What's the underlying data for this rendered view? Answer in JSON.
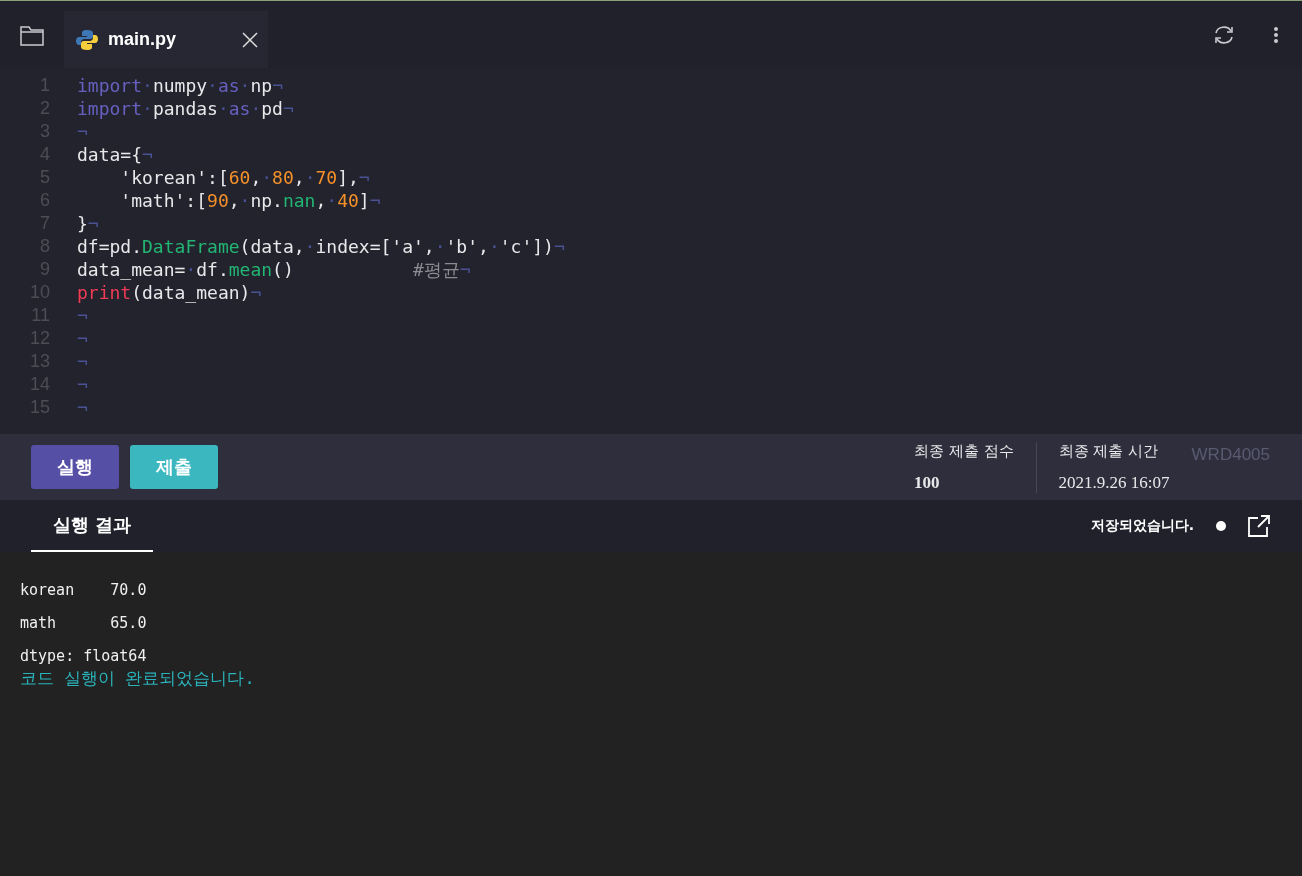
{
  "tabs": [
    {
      "label": "main.py",
      "selected": true
    }
  ],
  "editor": {
    "lines": [
      {
        "number": "1",
        "tokens": [
          {
            "kind": "kw",
            "text": "import"
          },
          {
            "kind": "ws",
            "text": "·"
          },
          {
            "kind": "id",
            "text": "numpy"
          },
          {
            "kind": "ws",
            "text": "·"
          },
          {
            "kind": "kw",
            "text": "as"
          },
          {
            "kind": "ws",
            "text": "·"
          },
          {
            "kind": "id",
            "text": "np"
          },
          {
            "kind": "ws",
            "text": "¬"
          }
        ]
      },
      {
        "number": "2",
        "tokens": [
          {
            "kind": "kw",
            "text": "import"
          },
          {
            "kind": "ws",
            "text": "·"
          },
          {
            "kind": "id",
            "text": "pandas"
          },
          {
            "kind": "ws",
            "text": "·"
          },
          {
            "kind": "kw",
            "text": "as"
          },
          {
            "kind": "ws",
            "text": "·"
          },
          {
            "kind": "id",
            "text": "pd"
          },
          {
            "kind": "ws",
            "text": "¬"
          }
        ]
      },
      {
        "number": "3",
        "tokens": [
          {
            "kind": "ws",
            "text": "¬"
          }
        ]
      },
      {
        "number": "4",
        "tokens": [
          {
            "kind": "id",
            "text": "data={"
          },
          {
            "kind": "ws",
            "text": "¬"
          }
        ]
      },
      {
        "number": "5",
        "tokens": [
          {
            "kind": "id",
            "text": "    'korean':["
          },
          {
            "kind": "num",
            "text": "60"
          },
          {
            "kind": "id",
            "text": ","
          },
          {
            "kind": "ws",
            "text": "·"
          },
          {
            "kind": "num",
            "text": "80"
          },
          {
            "kind": "id",
            "text": ","
          },
          {
            "kind": "ws",
            "text": "·"
          },
          {
            "kind": "num",
            "text": "70"
          },
          {
            "kind": "id",
            "text": "],"
          },
          {
            "kind": "ws",
            "text": "¬"
          }
        ]
      },
      {
        "number": "6",
        "tokens": [
          {
            "kind": "id",
            "text": "    'math':["
          },
          {
            "kind": "num",
            "text": "90"
          },
          {
            "kind": "id",
            "text": ","
          },
          {
            "kind": "ws",
            "text": "·"
          },
          {
            "kind": "id",
            "text": "np."
          },
          {
            "kind": "fn",
            "text": "nan"
          },
          {
            "kind": "id",
            "text": ","
          },
          {
            "kind": "ws",
            "text": "·"
          },
          {
            "kind": "num",
            "text": "40"
          },
          {
            "kind": "id",
            "text": "]"
          },
          {
            "kind": "ws",
            "text": "¬"
          }
        ]
      },
      {
        "number": "7",
        "tokens": [
          {
            "kind": "id",
            "text": "}"
          },
          {
            "kind": "ws",
            "text": "¬"
          }
        ]
      },
      {
        "number": "8",
        "tokens": [
          {
            "kind": "id",
            "text": "df=pd."
          },
          {
            "kind": "fn",
            "text": "DataFrame"
          },
          {
            "kind": "id",
            "text": "(data,"
          },
          {
            "kind": "ws",
            "text": "·"
          },
          {
            "kind": "id",
            "text": "index=['a',"
          },
          {
            "kind": "ws",
            "text": "·"
          },
          {
            "kind": "id",
            "text": "'b',"
          },
          {
            "kind": "ws",
            "text": "·"
          },
          {
            "kind": "id",
            "text": "'c'])"
          },
          {
            "kind": "ws",
            "text": "¬"
          }
        ]
      },
      {
        "number": "9",
        "tokens": [
          {
            "kind": "id",
            "text": "data_mean="
          },
          {
            "kind": "ws",
            "text": "·"
          },
          {
            "kind": "id",
            "text": "df."
          },
          {
            "kind": "fn",
            "text": "mean"
          },
          {
            "kind": "id",
            "text": "()           "
          },
          {
            "kind": "cm",
            "text": "#평균"
          },
          {
            "kind": "ws",
            "text": "¬"
          }
        ]
      },
      {
        "number": "10",
        "tokens": [
          {
            "kind": "bi",
            "text": "print"
          },
          {
            "kind": "id",
            "text": "(data_mean)"
          },
          {
            "kind": "ws",
            "text": "¬"
          }
        ]
      },
      {
        "number": "11",
        "tokens": [
          {
            "kind": "ws",
            "text": "¬"
          }
        ]
      },
      {
        "number": "12",
        "tokens": [
          {
            "kind": "ws",
            "text": "¬"
          }
        ]
      },
      {
        "number": "13",
        "tokens": [
          {
            "kind": "ws",
            "text": "¬"
          }
        ]
      },
      {
        "number": "14",
        "tokens": [
          {
            "kind": "ws",
            "text": "¬"
          }
        ]
      },
      {
        "number": "15",
        "tokens": [
          {
            "kind": "ws",
            "text": "¬"
          }
        ]
      }
    ]
  },
  "actions": [
    {
      "label": "실행",
      "kind": "run"
    },
    {
      "label": "제출",
      "kind": "submit"
    }
  ],
  "stats": [
    {
      "label": "최종 제출 점수",
      "value": "100"
    },
    {
      "label": "최종 제출 시간",
      "value": "2021.9.26 16:07"
    }
  ],
  "watermark_code": "WRD4005",
  "result_tab": {
    "label": "실행 결과",
    "selected": true
  },
  "save_status": "저장되었습니다.",
  "output": [
    {
      "kind": "stdout",
      "text": "korean    70.0"
    },
    {
      "kind": "stdout",
      "text": "math      65.0"
    },
    {
      "kind": "stdout",
      "text": "dtype: float64"
    },
    {
      "kind": "status",
      "text": "코드 실행이 완료되었습니다."
    }
  ]
}
